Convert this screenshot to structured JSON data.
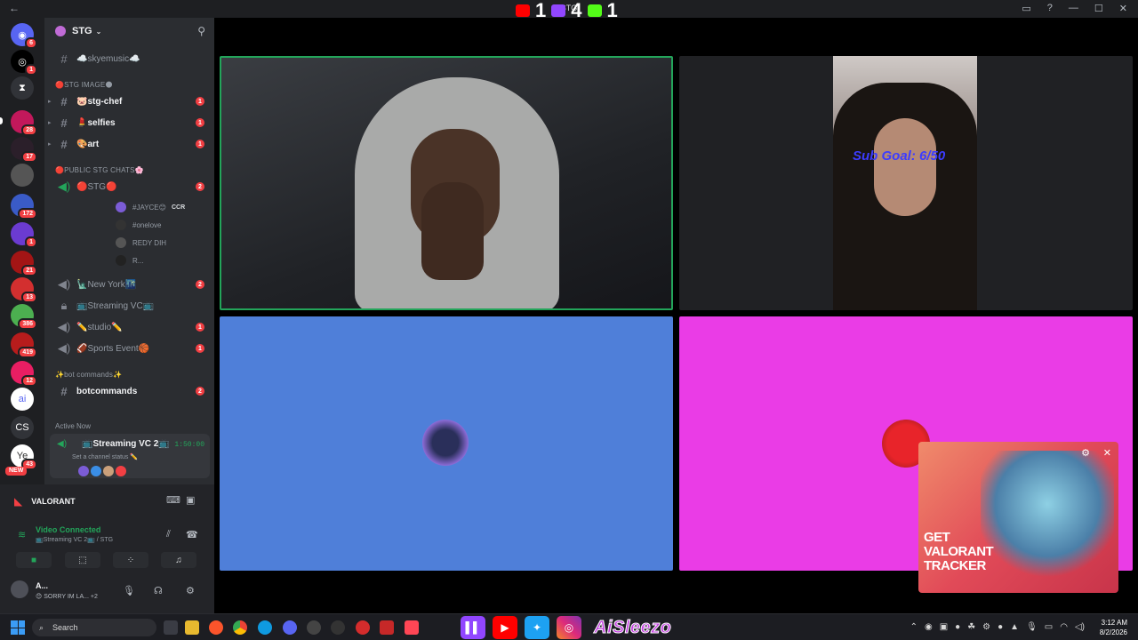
{
  "window": {
    "title": "STG",
    "nav_back": "←",
    "nav_forward": "→"
  },
  "scoreboard": {
    "youtube_count": "1",
    "twitch_count": "4",
    "kick_count": "1",
    "colors": {
      "youtube": "#ff0000",
      "twitch": "#9146ff",
      "kick": "#53fc18"
    }
  },
  "server_badges": [
    "6",
    "1",
    "28",
    "17",
    "172",
    "1",
    "21",
    "13",
    "386",
    "419",
    "12",
    "43"
  ],
  "server_labels": {
    "cs": "CS",
    "new": "NEW",
    "ye": "Ye"
  },
  "sidebar": {
    "guild_name": "STG",
    "channels": [
      {
        "name": "☁️skyemusic☁️",
        "type": "text",
        "unread": false
      },
      {
        "category": "🔴STG IMAGE🌑"
      },
      {
        "name": "🐷stg-chef",
        "type": "text",
        "unread": true,
        "badge": "1"
      },
      {
        "name": "💄selfies",
        "type": "text",
        "unread": true,
        "badge": "1"
      },
      {
        "name": "🎨art",
        "type": "text",
        "unread": true,
        "badge": "1"
      },
      {
        "category": "🔴PUBLIC STG CHATS🌸"
      },
      {
        "name": "🔴STG🔴",
        "type": "voice",
        "unread": false,
        "badge": "2"
      }
    ],
    "voice_users": [
      {
        "name": "#JAYCE😊",
        "tag": "CCR"
      },
      {
        "name": "#onelove",
        "tag": ""
      },
      {
        "name": "REDY DIH",
        "tag": ""
      },
      {
        "name": "R...",
        "tag": ""
      }
    ],
    "more_channels": [
      {
        "name": "🗽New York🌃",
        "type": "voice",
        "badge": "2"
      },
      {
        "name": "📺Streaming VC📺",
        "type": "locked",
        "badge": ""
      },
      {
        "name": "✏️studio✏️",
        "type": "voice",
        "badge": "1"
      },
      {
        "name": "🏈Sports Event🏀",
        "type": "voice",
        "badge": "1"
      }
    ],
    "bot_category": "✨bot commands✨",
    "bot_channel": {
      "name": "botcommands",
      "badge": "2"
    },
    "active_now": {
      "label": "Active Now",
      "channel": "📺Streaming VC 2📺",
      "timer": "1:50:00",
      "status": "Set a channel status ✏️"
    }
  },
  "rtc_panel": {
    "game": "VALORANT",
    "connection": "Video Connected",
    "location": "📺Streaming VC 2📺 / STG",
    "user_name": "A...",
    "user_status": "😊 SORRY IM LA...",
    "extra": "+2"
  },
  "stream": {
    "sub_goal": "Sub Goal: 6/50"
  },
  "ad": {
    "text_line1": "GET",
    "text_line2": "VALORANT",
    "text_line3": "TRACKER"
  },
  "taskbar": {
    "search_placeholder": "Search",
    "handle": "AiSleezo",
    "time": "3:12 AM",
    "date": "8/2/2026"
  }
}
